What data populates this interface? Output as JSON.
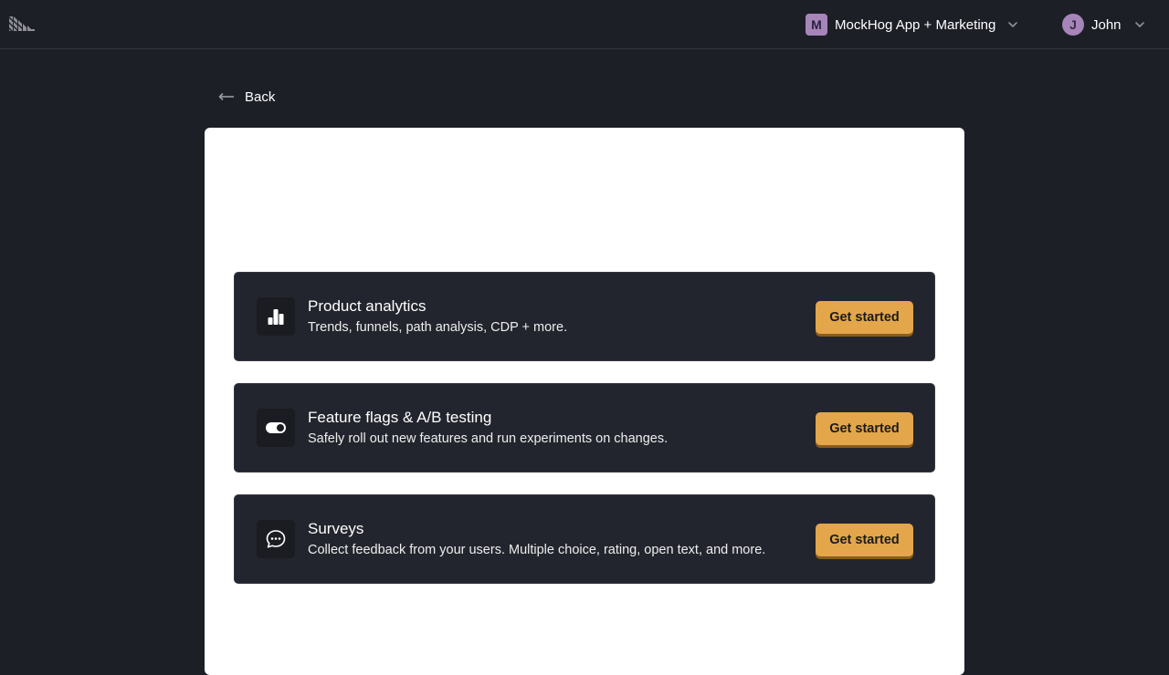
{
  "header": {
    "project": {
      "initial": "M",
      "name": "MockHog App + Marketing",
      "icon": "chevron-down-icon"
    },
    "user": {
      "initial": "J",
      "name": "John",
      "icon": "chevron-down-icon"
    },
    "logo_icon": "hedgehog-logo-icon",
    "accent_color": "#a685b8"
  },
  "nav": {
    "back_label": "Back",
    "back_icon": "arrow-left-icon"
  },
  "products": [
    {
      "title": "Product analytics",
      "description": "Trends, funnels, path analysis, CDP + more.",
      "icon": "bar-chart-icon",
      "cta_label": "Get started"
    },
    {
      "title": "Feature flags & A/B testing",
      "description": "Safely roll out new features and run experiments on changes.",
      "icon": "toggle-icon",
      "cta_label": "Get started"
    },
    {
      "title": "Surveys",
      "description": "Collect feedback from your users. Multiple choice, rating, open text, and more.",
      "icon": "chat-bubble-icon",
      "cta_label": "Get started"
    }
  ],
  "colors": {
    "background": "#1d1f27",
    "card": "#23252e",
    "cta": "#e3a64b"
  }
}
